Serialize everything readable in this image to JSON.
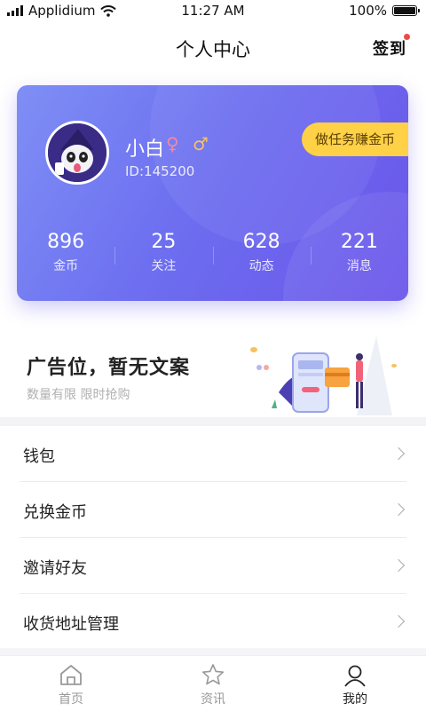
{
  "status_bar": {
    "carrier": "Applidium",
    "time": "11:27 AM",
    "battery": "100%"
  },
  "header": {
    "title": "个人中心",
    "checkin_label": "签到"
  },
  "profile": {
    "nickname": "小白",
    "gender_female_symbol": "♀",
    "gender_male_symbol": "♂",
    "user_id": "ID:145200",
    "task_button": "做任务赚金币",
    "stats": [
      {
        "value": "896",
        "label": "金币"
      },
      {
        "value": "25",
        "label": "关注"
      },
      {
        "value": "628",
        "label": "动态"
      },
      {
        "value": "221",
        "label": "消息"
      }
    ]
  },
  "ad": {
    "title": "广告位，暂无文案",
    "subtitle": "数量有限 限时抢购"
  },
  "menu": [
    {
      "label": "钱包"
    },
    {
      "label": "兑换金币"
    },
    {
      "label": "邀请好友"
    },
    {
      "label": "收货地址管理"
    }
  ],
  "tabbar": [
    {
      "label": "首页",
      "icon": "home-icon"
    },
    {
      "label": "资讯",
      "icon": "star-icon"
    },
    {
      "label": "我的",
      "icon": "user-icon",
      "active": true
    }
  ],
  "colors": {
    "card_start": "#7f8ff5",
    "card_end": "#6a55ea",
    "accent_yellow": "#ffd146",
    "badge_red": "#ec4a4a"
  }
}
